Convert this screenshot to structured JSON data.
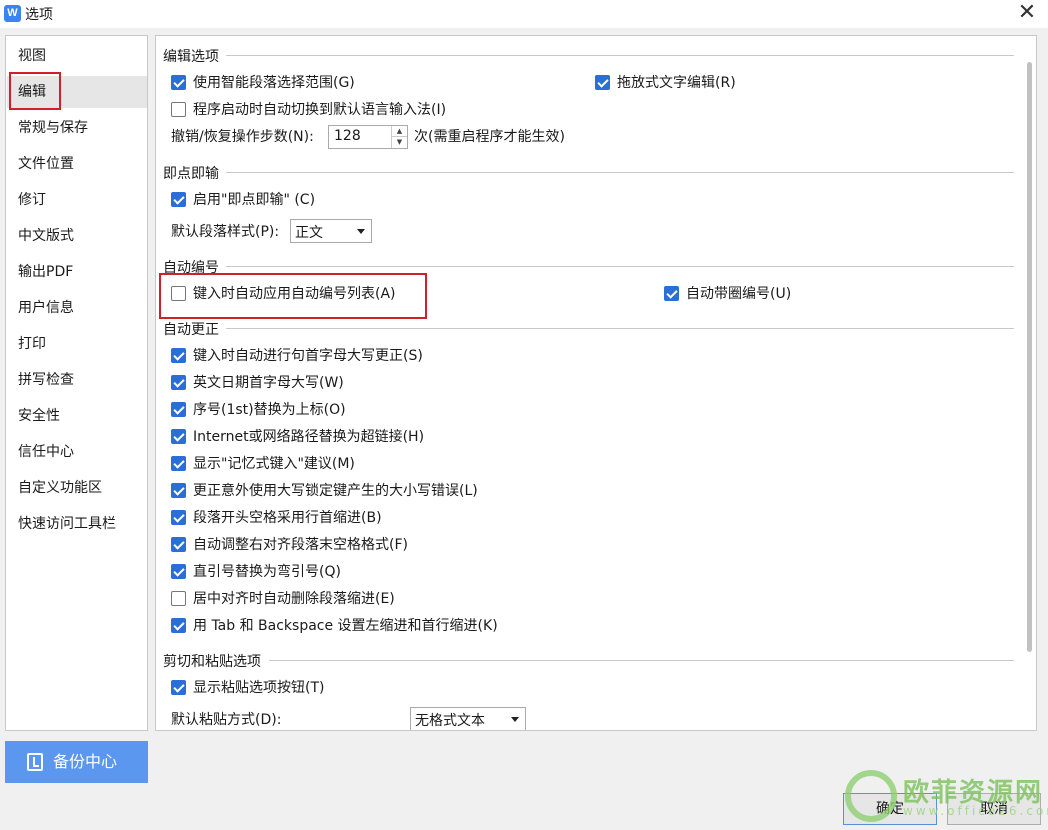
{
  "window": {
    "title": "选项",
    "app_icon_letter": "W",
    "close": "✕"
  },
  "sidebar": {
    "items": [
      {
        "label": "视图"
      },
      {
        "label": "编辑"
      },
      {
        "label": "常规与保存"
      },
      {
        "label": "文件位置"
      },
      {
        "label": "修订"
      },
      {
        "label": "中文版式"
      },
      {
        "label": "输出PDF"
      },
      {
        "label": "用户信息"
      },
      {
        "label": "打印"
      },
      {
        "label": "拼写检查"
      },
      {
        "label": "安全性"
      },
      {
        "label": "信任中心"
      },
      {
        "label": "自定义功能区"
      },
      {
        "label": "快速访问工具栏"
      }
    ],
    "selected": "编辑"
  },
  "backup": {
    "label": "备份中心"
  },
  "sections": {
    "edit_options": {
      "title": "编辑选项",
      "smart_paragraph": {
        "label": "使用智能段落选择范围(G)",
        "checked": true
      },
      "drag_edit": {
        "label": "拖放式文字编辑(R)",
        "checked": true
      },
      "auto_switch_ime": {
        "label": "程序启动时自动切换到默认语言输入法(I)",
        "checked": false
      },
      "undo_steps_label": "撤销/恢复操作步数(N):",
      "undo_steps_value": "128",
      "undo_steps_note": "次(需重启程序才能生效)"
    },
    "click_type": {
      "title": "即点即输",
      "enable": {
        "label": "启用\"即点即输\" (C)",
        "checked": true
      },
      "default_style_label": "默认段落样式(P):",
      "default_style_value": "正文"
    },
    "auto_numbering": {
      "title": "自动编号",
      "auto_list": {
        "label": "键入时自动应用自动编号列表(A)",
        "checked": false
      },
      "circled_number": {
        "label": "自动带圈编号(U)",
        "checked": true
      }
    },
    "autocorrect": {
      "title": "自动更正",
      "items": [
        {
          "label": "键入时自动进行句首字母大写更正(S)",
          "checked": true
        },
        {
          "label": "英文日期首字母大写(W)",
          "checked": true
        },
        {
          "label": "序号(1st)替换为上标(O)",
          "checked": true
        },
        {
          "label": "Internet或网络路径替换为超链接(H)",
          "checked": true
        },
        {
          "label": "显示\"记忆式键入\"建议(M)",
          "checked": true
        },
        {
          "label": "更正意外使用大写锁定键产生的大小写错误(L)",
          "checked": true
        },
        {
          "label": "段落开头空格采用行首缩进(B)",
          "checked": true
        },
        {
          "label": "自动调整右对齐段落末空格格式(F)",
          "checked": true
        },
        {
          "label": "直引号替换为弯引号(Q)",
          "checked": true
        },
        {
          "label": "居中对齐时自动删除段落缩进(E)",
          "checked": false
        },
        {
          "label": "用 Tab 和 Backspace 设置左缩进和首行缩进(K)",
          "checked": true
        }
      ]
    },
    "cut_paste": {
      "title": "剪切和粘贴选项",
      "show_paste_button": {
        "label": "显示粘贴选项按钮(T)",
        "checked": true
      },
      "default_paste_label": "默认粘贴方式(D):",
      "default_paste_value": "无格式文本"
    }
  },
  "buttons": {
    "ok": "确定",
    "cancel": "取消"
  },
  "watermark": {
    "text": "欧菲资源网",
    "sub": "www.office26.com"
  },
  "colors": {
    "accent": "#2a6ed8",
    "highlight": "#d0202a",
    "backup_bg": "#5b96ef"
  }
}
